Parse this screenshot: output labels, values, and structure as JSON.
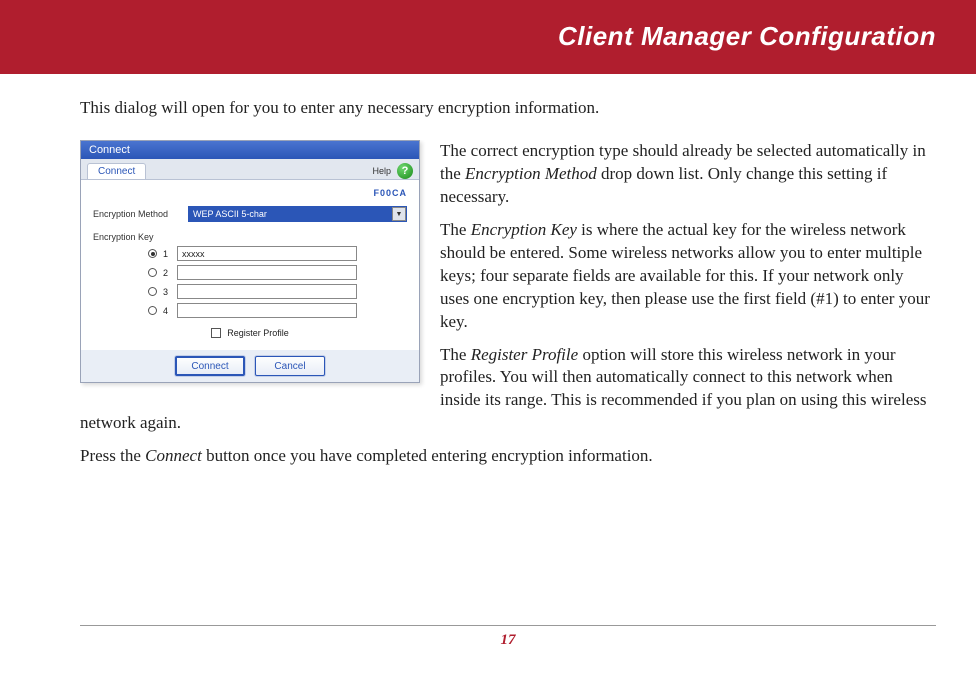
{
  "header": {
    "title": "Client Manager Configuration"
  },
  "intro": "This dialog will open for you to enter any necessary encryption information.",
  "dialog": {
    "title": "Connect",
    "tab": "Connect",
    "help_label": "Help",
    "ap_name": "F00CA",
    "enc_method_label": "Encryption Method",
    "enc_method_value": "WEP ASCII 5-char",
    "enc_key_label": "Encryption Key",
    "keys": [
      {
        "n": "1",
        "checked": true,
        "value": "xxxxx"
      },
      {
        "n": "2",
        "checked": false,
        "value": ""
      },
      {
        "n": "3",
        "checked": false,
        "value": ""
      },
      {
        "n": "4",
        "checked": false,
        "value": ""
      }
    ],
    "register_label": "Register Profile",
    "connect_btn": "Connect",
    "cancel_btn": "Cancel"
  },
  "paras": {
    "p1a": "The correct encryption type should already be selected automatically in the ",
    "p1i": "Encryption Method",
    "p1b": " drop down list.  Only change this setting if necessary.",
    "p2a": "The ",
    "p2i": "Encryption Key",
    "p2b": " is where the actual key for the wireless network should be entered.  Some wireless networks allow you to enter multiple keys; four separate fields are available for this.  If your network only uses one encryption key, then please use the first field (#1) to enter your key.",
    "p3a": "The ",
    "p3i": "Register Profile",
    "p3b": " option will store this wireless network in your profiles.  You will then automatically connect to this network when inside its range.  This is recommended if you plan on using this wireless network again.",
    "p4a": "Press the ",
    "p4i": "Connect",
    "p4b": " button once you have completed entering encryption information."
  },
  "page_number": "17"
}
